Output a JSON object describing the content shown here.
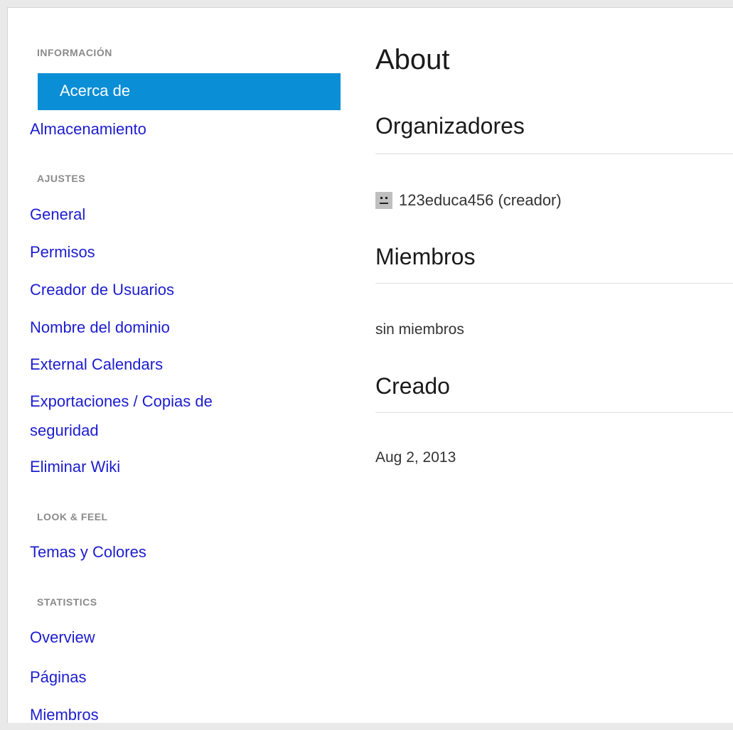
{
  "sidebar": {
    "sections": {
      "informacion": "INFORMACIÓN",
      "ajustes": "AJUSTES",
      "look_feel": "LOOK & FEEL",
      "statistics": "STATISTICS"
    },
    "items": {
      "acerca_de": "Acerca de",
      "almacenamiento": "Almacenamiento",
      "general": "General",
      "permisos": "Permisos",
      "creador_usuarios": "Creador de Usuarios",
      "nombre_dominio": "Nombre del dominio",
      "external_calendars": "External Calendars",
      "exportaciones": "Exportaciones / Copias de seguridad",
      "eliminar_wiki": "Eliminar Wiki",
      "temas_colores": "Temas y Colores",
      "overview": "Overview",
      "paginas": "Páginas",
      "miembros": "Miembros"
    },
    "active_item": "acerca_de",
    "active_color": "#0a8ed6",
    "link_color": "#1c1ccf"
  },
  "main": {
    "title": "About",
    "organizers_heading": "Organizadores",
    "organizer": "123educa456 (creador)",
    "organizer_icon": "avatar-icon",
    "members_heading": "Miembros",
    "members_text": "sin miembros",
    "created_heading": "Creado",
    "created_date": "Aug 2, 2013"
  }
}
